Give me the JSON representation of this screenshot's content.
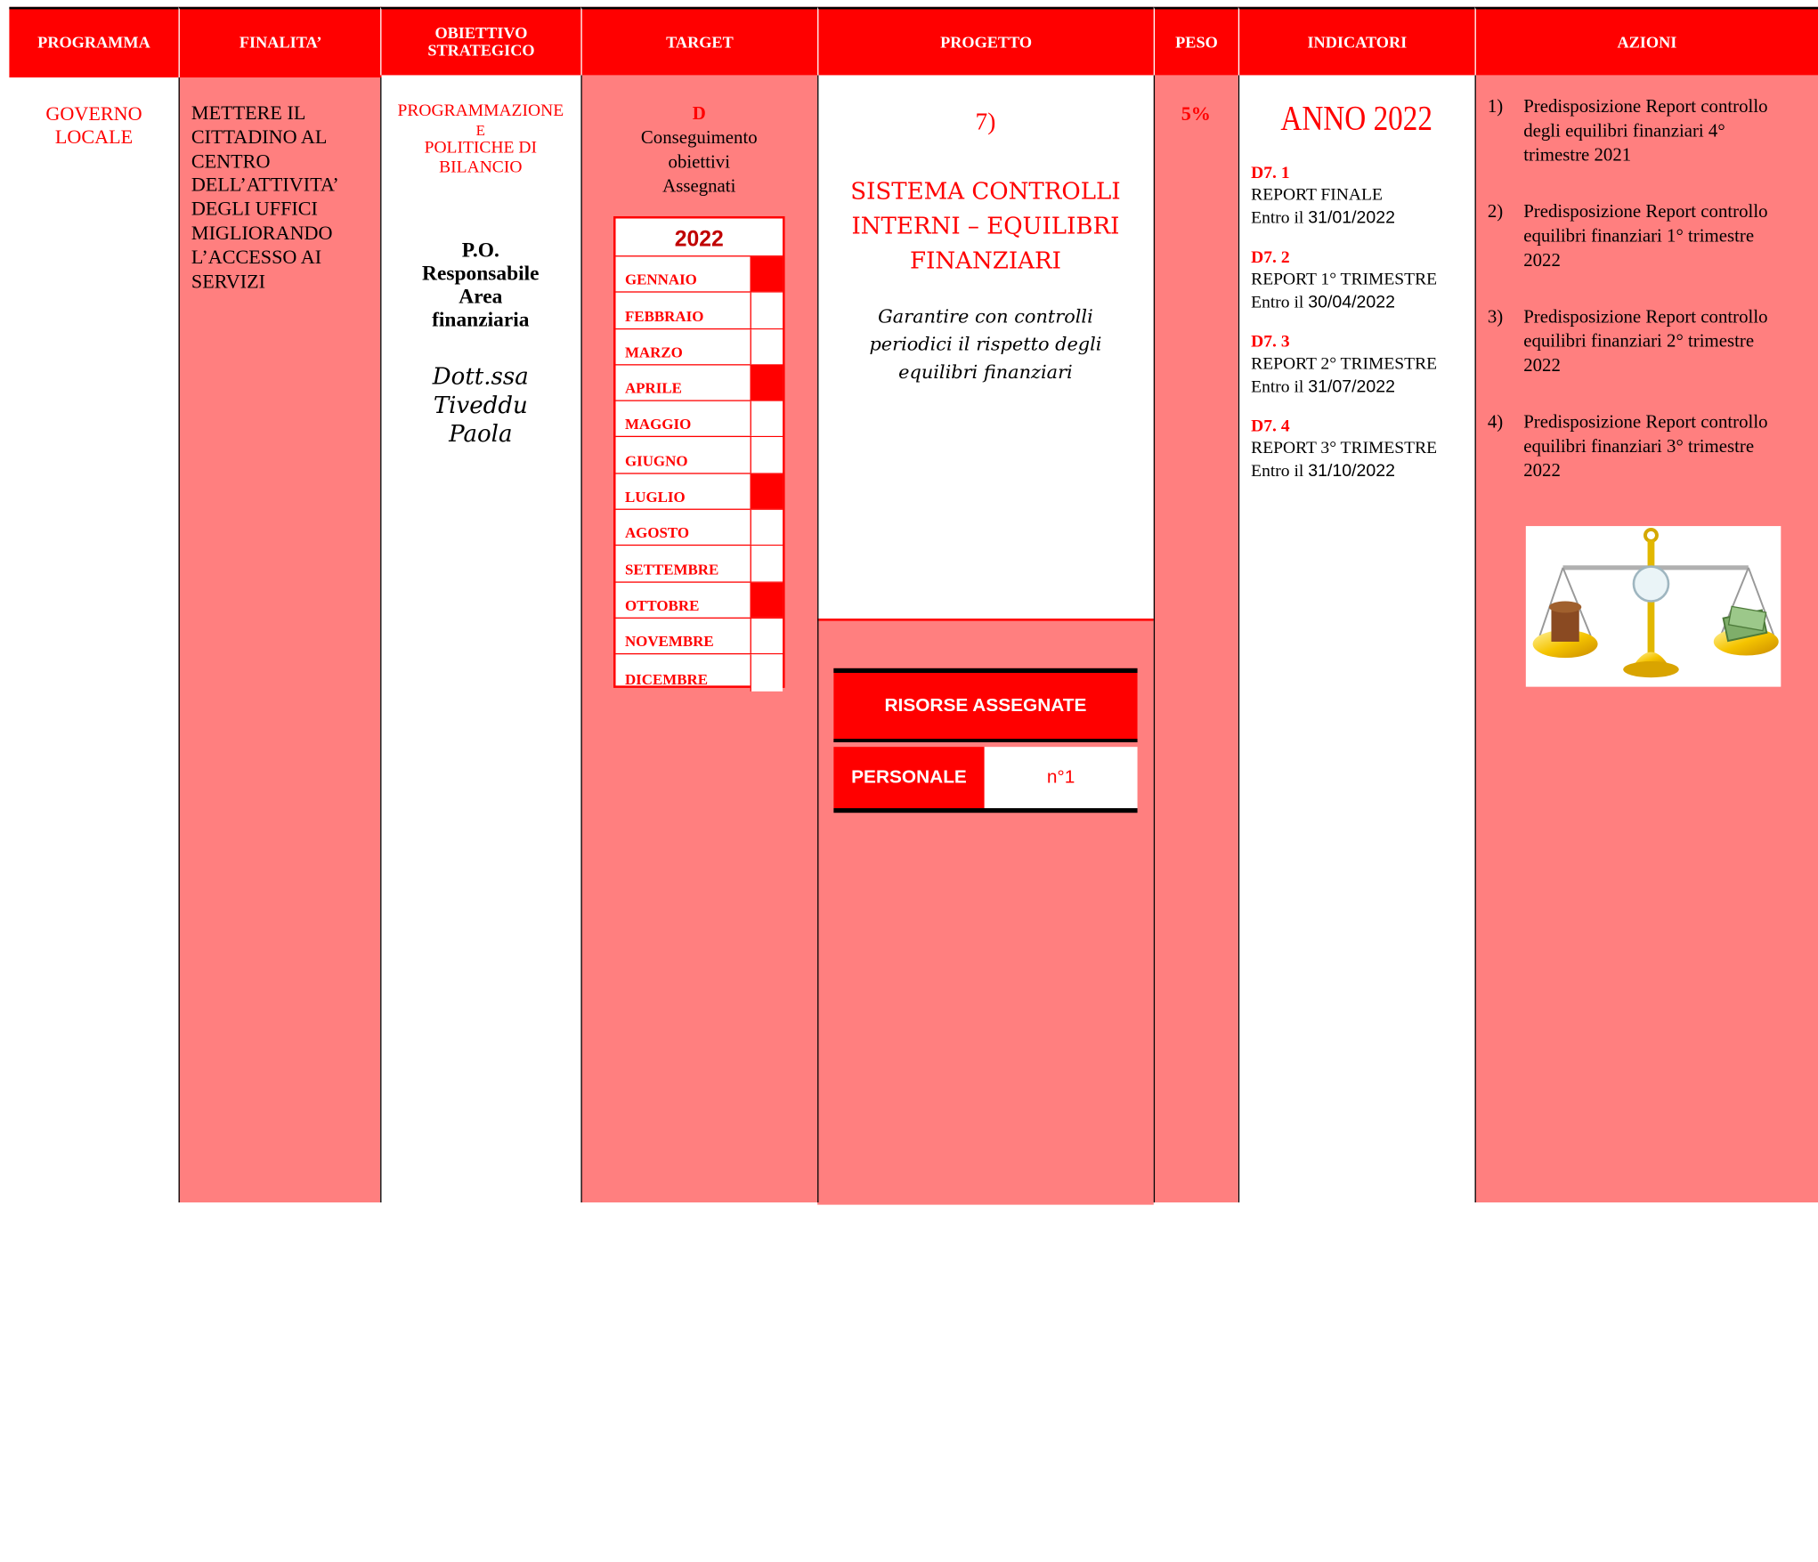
{
  "headers": {
    "programma": "PROGRAMMA",
    "finalita": "FINALITA’",
    "obiettivo": "OBIETTIVO STRATEGICO",
    "target": "TARGET",
    "progetto": "PROGETTO",
    "peso": "PESO",
    "indicatori": "INDICATORI",
    "azioni": "AZIONI"
  },
  "programma": {
    "line1": "GOVERNO",
    "line2": "LOCALE"
  },
  "finalita": {
    "lines": [
      "METTERE IL",
      "CITTADINO AL",
      "CENTRO",
      "DELL’ATTIVITA’",
      "DEGLI UFFICI",
      "MIGLIORANDO",
      "L’ACCESSO AI",
      "SERVIZI"
    ]
  },
  "obiettivo": {
    "area_lines": [
      "PROGRAMMAZIONE",
      "E",
      "POLITICHE DI",
      "BILANCIO"
    ],
    "resp_lines": [
      "P.O.",
      "Responsabile",
      "Area",
      "finanziaria"
    ],
    "name_lines": [
      "Dott.ssa",
      "Tiveddu",
      "Paola"
    ]
  },
  "target": {
    "code": "D",
    "lines": [
      "Conseguimento",
      "obiettivi",
      "Assegnati"
    ],
    "year": "2022",
    "months": [
      {
        "name": "GENNAIO",
        "active": true
      },
      {
        "name": "FEBBRAIO",
        "active": false
      },
      {
        "name": "MARZO",
        "active": false
      },
      {
        "name": "APRILE",
        "active": true
      },
      {
        "name": "MAGGIO",
        "active": false
      },
      {
        "name": "GIUGNO",
        "active": false
      },
      {
        "name": "LUGLIO",
        "active": true
      },
      {
        "name": "AGOSTO",
        "active": false
      },
      {
        "name": "SETTEMBRE",
        "active": false
      },
      {
        "name": "OTTOBRE",
        "active": true
      },
      {
        "name": "NOVEMBRE",
        "active": false
      },
      {
        "name": "DICEMBRE",
        "active": false
      }
    ]
  },
  "progetto": {
    "number": "7)",
    "title_lines": [
      "SISTEMA CONTROLLI",
      "INTERNI – EQUILIBRI",
      "FINANZIARI"
    ],
    "desc_lines": [
      "Garantire con controlli",
      "periodici il rispetto degli",
      "equilibri finanziari"
    ],
    "risorse_label": "RISORSE ASSEGNATE",
    "personale_label": "PERSONALE",
    "personale_value": "n°1"
  },
  "peso": {
    "value": "5%"
  },
  "indicatori": {
    "anno": "ANNO 2022",
    "items": [
      {
        "code": "D7. 1",
        "label": "REPORT FINALE",
        "entro": "Entro il",
        "date": "31/01/2022"
      },
      {
        "code": "D7. 2",
        "label": "REPORT 1° TRIMESTRE",
        "entro": "Entro il",
        "date": "30/04/2022"
      },
      {
        "code": "D7. 3",
        "label": "REPORT 2° TRIMESTRE",
        "entro": "Entro il",
        "date": "31/07/2022"
      },
      {
        "code": "D7. 4",
        "label": "REPORT 3° TRIMESTRE",
        "entro": "Entro il",
        "date": "31/10/2022"
      }
    ]
  },
  "azioni": {
    "items": [
      {
        "num": "1)",
        "lines": [
          "Predisposizione Report controllo",
          "degli equilibri finanziari 4°",
          "trimestre 2021"
        ]
      },
      {
        "num": "2)",
        "lines": [
          "Predisposizione Report controllo",
          "equilibri finanziari 1° trimestre",
          "2022"
        ]
      },
      {
        "num": "3)",
        "lines": [
          "Predisposizione Report controllo",
          "equilibri finanziari 2° trimestre",
          "2022"
        ]
      },
      {
        "num": "4)",
        "lines": [
          "Predisposizione Report controllo",
          "equilibri finanziari 3° trimestre",
          "2022"
        ]
      }
    ],
    "image_icon": "balance-scale-icon"
  },
  "colors": {
    "header_red": "#ff0000",
    "pink": "#ff7f7f",
    "text_red": "#ff0000"
  }
}
